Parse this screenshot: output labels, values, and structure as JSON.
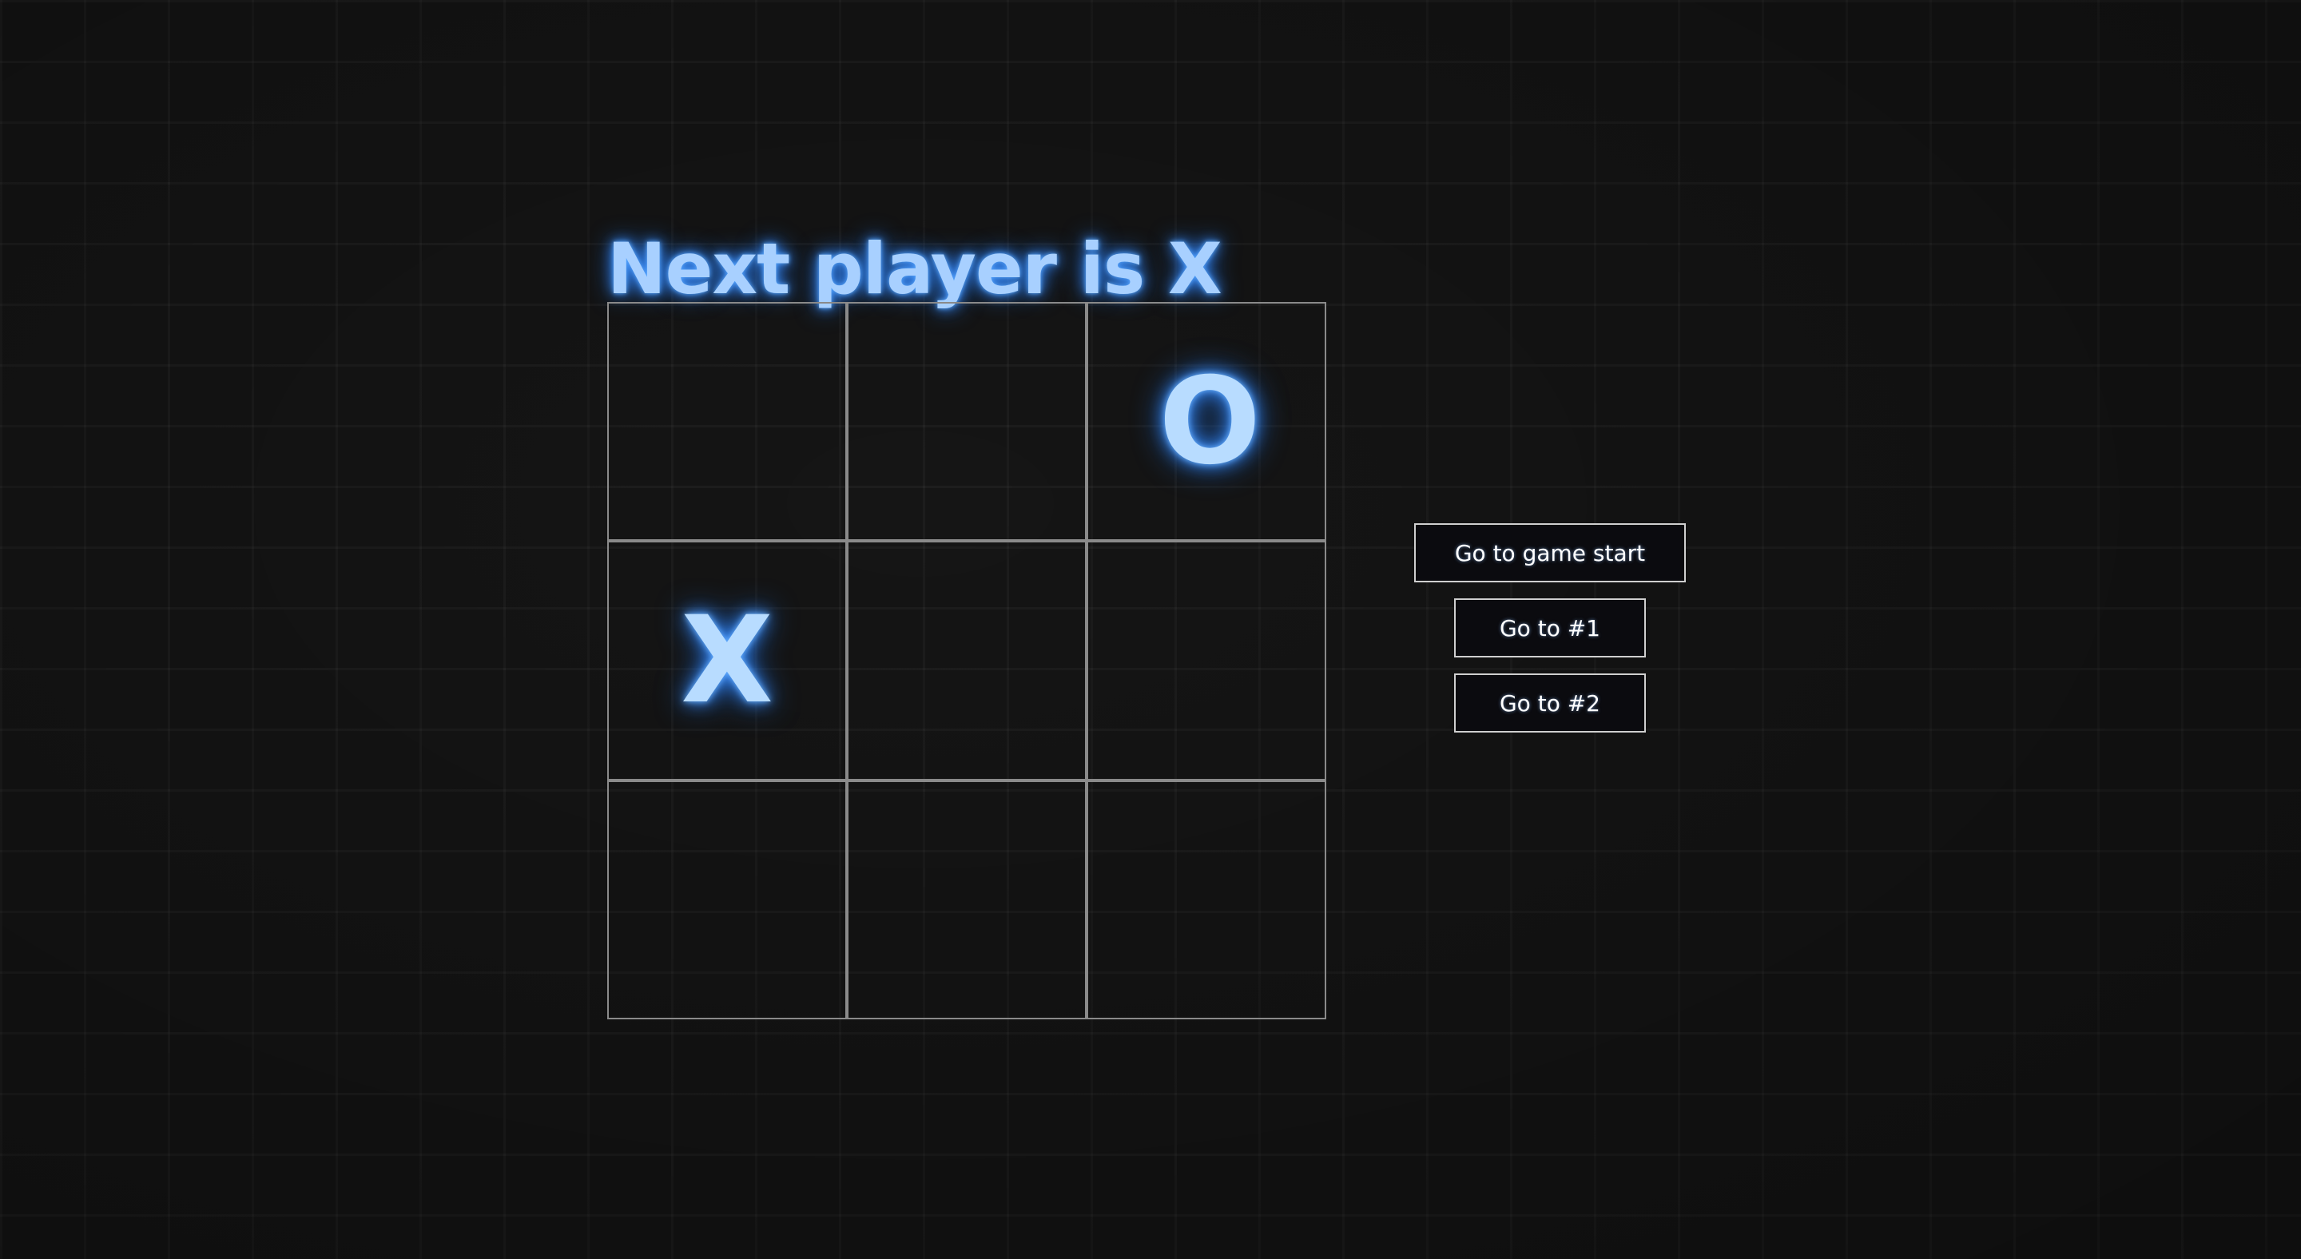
{
  "status": {
    "text": "Next player is X"
  },
  "board": {
    "squares": [
      "",
      "",
      "O",
      "X",
      "",
      "",
      "",
      "",
      ""
    ]
  },
  "moves": [
    {
      "label": "Go to game start"
    },
    {
      "label": "Go to #1"
    },
    {
      "label": "Go to #2"
    }
  ],
  "colors": {
    "glow": "#3d8fff",
    "mark": "#b8dcff",
    "grid": "#8a8a8a",
    "background": "#151515"
  }
}
